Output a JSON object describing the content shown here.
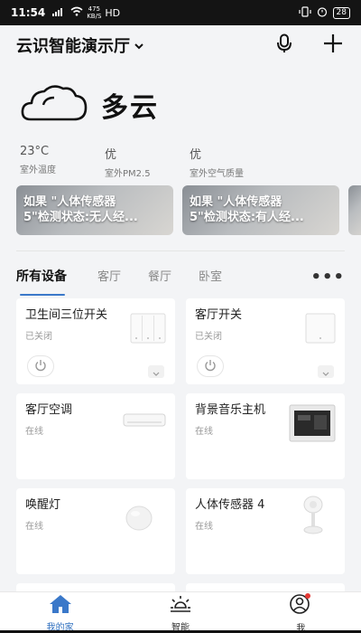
{
  "status_bar": {
    "time": "11:54",
    "signal": "4G",
    "net_speed": "475",
    "net_unit": "KB/S",
    "hd": "HD",
    "battery": "28"
  },
  "header": {
    "home_name": "云识智能演示厅",
    "icons": [
      "chevron-down-icon",
      "microphone-icon",
      "plus-icon"
    ]
  },
  "weather": {
    "condition": "多云",
    "icon": "cloud-icon",
    "stats": [
      {
        "value": "23°C",
        "label": "室外温度"
      },
      {
        "value": "优",
        "label": "室外PM2.5"
      },
      {
        "value": "优",
        "label": "室外空气质量"
      }
    ]
  },
  "scenes": [
    {
      "text": "如果 \"人体传感器 5\"检测状态:无人经..."
    },
    {
      "text": "如果 \"人体传感器 5\"检测状态:有人经..."
    }
  ],
  "tabs": [
    "所有设备",
    "客厅",
    "餐厅",
    "卧室"
  ],
  "devices": [
    {
      "name": "卫生间三位开关",
      "status": "已关闭",
      "icon": "triple-switch-icon"
    },
    {
      "name": "客厅开关",
      "status": "已关闭",
      "icon": "single-switch-icon"
    },
    {
      "name": "客厅空调",
      "status": "在线",
      "icon": "air-conditioner-icon"
    },
    {
      "name": "背景音乐主机",
      "status": "在线",
      "icon": "music-host-icon"
    },
    {
      "name": "唤醒灯",
      "status": "在线",
      "icon": "wake-lamp-icon"
    },
    {
      "name": "人体传感器 4",
      "status": "在线",
      "icon": "motion-sensor-icon"
    }
  ],
  "bottom_nav": [
    {
      "label": "我的家",
      "icon": "home-icon",
      "active": true
    },
    {
      "label": "智能",
      "icon": "sun-icon",
      "active": false
    },
    {
      "label": "我",
      "icon": "user-icon",
      "active": false
    }
  ],
  "colors": {
    "accent": "#3a78c9",
    "badge": "#e53935"
  }
}
